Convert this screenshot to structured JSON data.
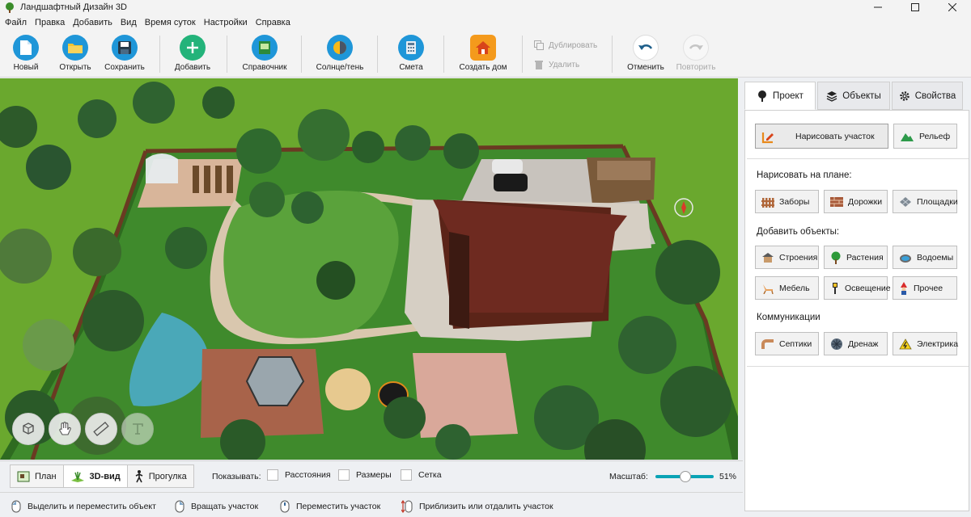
{
  "window": {
    "title": "Ландшафтный Дизайн 3D"
  },
  "menu": [
    "Файл",
    "Правка",
    "Добавить",
    "Вид",
    "Время суток",
    "Настройки",
    "Справка"
  ],
  "toolbar": {
    "new": "Новый",
    "open": "Открыть",
    "save": "Сохранить",
    "add": "Добавить",
    "reference": "Справочник",
    "sun": "Солнце/тень",
    "estimate": "Смета",
    "house": "Создать дом",
    "duplicate": "Дублировать",
    "delete": "Удалить",
    "undo": "Отменить",
    "redo": "Повторить"
  },
  "viewmodes": {
    "plan": "План",
    "view3d": "3D-вид",
    "walk": "Прогулка"
  },
  "show": {
    "label": "Показывать:",
    "distances": "Расстояния",
    "sizes": "Размеры",
    "grid": "Сетка"
  },
  "scale": {
    "label": "Масштаб:",
    "value": "51%",
    "fraction": 0.51
  },
  "status": {
    "select": "Выделить и переместить объект",
    "rotate": "Вращать участок",
    "move": "Переместить участок",
    "zoom": "Приблизить или отдалить участок"
  },
  "panel": {
    "tabs": {
      "project": "Проект",
      "objects": "Объекты",
      "properties": "Свойства"
    },
    "draw_plot": "Нарисовать участок",
    "relief": "Рельеф",
    "draw_on_plan": "Нарисовать на плане:",
    "fences": "Заборы",
    "paths": "Дорожки",
    "platforms": "Площадки",
    "add_objects": "Добавить объекты:",
    "buildings": "Строения",
    "plants": "Растения",
    "ponds": "Водоемы",
    "furniture": "Мебель",
    "lighting": "Освещение",
    "other": "Прочее",
    "communications": "Коммуникации",
    "septic": "Септики",
    "drainage": "Дренаж",
    "electric": "Электрика"
  },
  "colors": {
    "accent": "#0aa3b5",
    "grass": "#6aa82e",
    "roof": "#6e2a20"
  }
}
